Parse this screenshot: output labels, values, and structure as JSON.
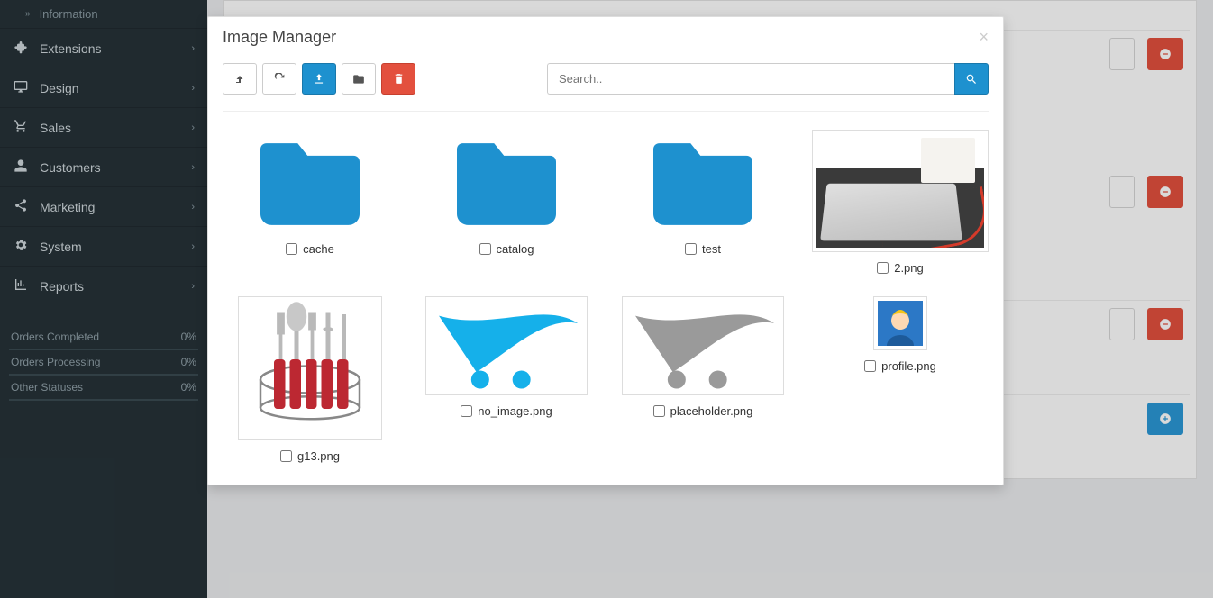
{
  "sidebar": {
    "sub_item": "Information",
    "items": [
      {
        "label": "Extensions"
      },
      {
        "label": "Design"
      },
      {
        "label": "Sales"
      },
      {
        "label": "Customers"
      },
      {
        "label": "Marketing"
      },
      {
        "label": "System"
      },
      {
        "label": "Reports"
      }
    ],
    "stats": [
      {
        "label": "Orders Completed",
        "value": "0%"
      },
      {
        "label": "Orders Processing",
        "value": "0%"
      },
      {
        "label": "Other Statuses",
        "value": "0%"
      }
    ]
  },
  "modal": {
    "title": "Image Manager",
    "search_placeholder": "Search..",
    "folders": [
      {
        "name": "cache"
      },
      {
        "name": "catalog"
      },
      {
        "name": "test"
      }
    ],
    "files": [
      {
        "name": "2.png",
        "kind": "photo"
      },
      {
        "name": "g13.png",
        "kind": "kitchen"
      },
      {
        "name": "no_image.png",
        "kind": "oc-blue"
      },
      {
        "name": "placeholder.png",
        "kind": "oc-grey"
      },
      {
        "name": "profile.png",
        "kind": "avatar"
      }
    ]
  }
}
